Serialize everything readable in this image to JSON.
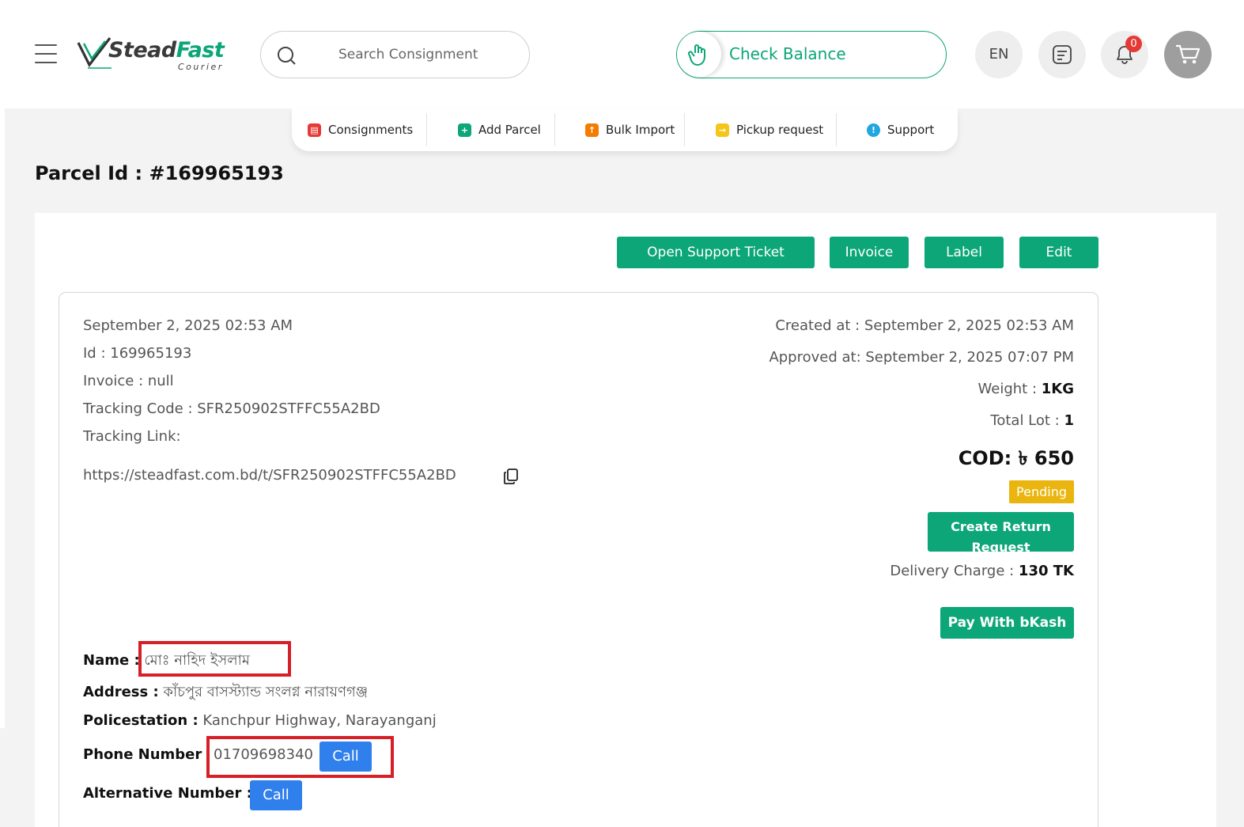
{
  "header": {
    "logo_main": "Stead",
    "logo_accent": "Fast",
    "logo_sub": "Courier",
    "search_placeholder": "Search Consignment",
    "check_balance": "Check Balance",
    "language": "EN",
    "notification_count": "0"
  },
  "subnav": {
    "items": [
      {
        "label": "Consignments",
        "icon": "consignment-icon",
        "color": "#e53935"
      },
      {
        "label": "Add Parcel",
        "icon": "plus-icon",
        "color": "#0ca678"
      },
      {
        "label": "Bulk Import",
        "icon": "upload-icon",
        "color": "#f57c00"
      },
      {
        "label": "Pickup request",
        "icon": "pickup-icon",
        "color": "#f5c518"
      },
      {
        "label": "Support",
        "icon": "info-icon",
        "color": "#1ea7e1"
      }
    ]
  },
  "page": {
    "title": "Parcel Id : #169965193"
  },
  "actions": {
    "open_support_ticket": "Open Support Ticket",
    "invoice": "Invoice",
    "label": "Label",
    "edit": "Edit"
  },
  "parcel": {
    "date": "September 2, 2025 02:53 AM",
    "id": "Id : 169965193",
    "invoice": "Invoice : null",
    "tracking_code": "Tracking Code : SFR250902STFFC55A2BD",
    "tracking_link_label": "Tracking Link:",
    "tracking_link": "https://steadfast.com.bd/t/SFR250902STFFC55A2BD",
    "created_at": "Created at : September 2, 2025 02:53 AM",
    "approved_at": "Approved at: September 2, 2025 07:07 PM",
    "weight_label": "Weight : ",
    "weight_value": "1KG",
    "total_lot_label": "Total Lot : ",
    "total_lot_value": "1",
    "cod": "COD: ৳ 650",
    "status": "Pending",
    "create_return": "Create Return Request",
    "delivery_charge_label": "Delivery Charge : ",
    "delivery_charge_value": "130 TK",
    "pay_bkash": "Pay With bKash"
  },
  "customer": {
    "name_label": "Name :",
    "name": "মোঃ নাহিদ ইসলাম",
    "address_label": "Address :",
    "address": "কাঁচপুর বাসস্ট্যান্ড সংলগ্ন নারায়ণগঞ্জ",
    "policestation_label": "Policestation :",
    "policestation": "Kanchpur Highway, Narayanganj",
    "phone_label": "Phone Number",
    "phone": "01709698340",
    "alt_label": "Alternative Number :",
    "call": "Call"
  },
  "colors": {
    "brand_green": "#0ca678",
    "pending_yellow": "#e9b50e",
    "call_blue": "#2f7fed",
    "highlight_red": "#d61f26"
  }
}
